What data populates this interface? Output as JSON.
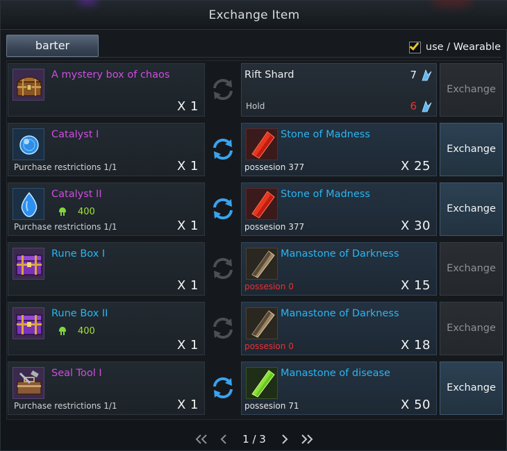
{
  "window": {
    "title": "Exchange Item"
  },
  "tabs": [
    {
      "label": "barter"
    }
  ],
  "filter": {
    "label": "use / Wearable",
    "checked": true
  },
  "rows": [
    {
      "source": {
        "name": "A mystery box of chaos",
        "qty": "X 1",
        "restriction": "",
        "cost": ""
      },
      "arrow_active": false,
      "target": {
        "name": "Rift Shard",
        "count": "7",
        "hold_label": "Hold",
        "hold": "6"
      },
      "button": {
        "label": "Exchange",
        "enabled": false
      }
    },
    {
      "source": {
        "name": "Catalyst I",
        "qty": "X 1",
        "restriction": "Purchase restrictions 1/1",
        "cost": ""
      },
      "arrow_active": true,
      "target": {
        "name": "Stone of Madness",
        "possession": "possesion 377",
        "qty": "X 25"
      },
      "button": {
        "label": "Exchange",
        "enabled": true
      }
    },
    {
      "source": {
        "name": "Catalyst II",
        "qty": "X 1",
        "restriction": "Purchase restrictions 1/1",
        "cost": "400"
      },
      "arrow_active": true,
      "target": {
        "name": "Stone of Madness",
        "possession": "possesion 377",
        "qty": "X 30"
      },
      "button": {
        "label": "Exchange",
        "enabled": true
      }
    },
    {
      "source": {
        "name": "Rune Box I",
        "qty": "X 1",
        "restriction": "",
        "cost": ""
      },
      "arrow_active": false,
      "target": {
        "name": "Manastone of Darkness",
        "possession": "possesion 0",
        "qty": "X 15"
      },
      "button": {
        "label": "Exchange",
        "enabled": false
      }
    },
    {
      "source": {
        "name": "Rune Box II",
        "qty": "X 1",
        "restriction": "",
        "cost": "400"
      },
      "arrow_active": false,
      "target": {
        "name": "Manastone of Darkness",
        "possession": "possesion 0",
        "qty": "X 18"
      },
      "button": {
        "label": "Exchange",
        "enabled": false
      }
    },
    {
      "source": {
        "name": "Seal Tool I",
        "qty": "X 1",
        "restriction": "Purchase restrictions 1/1",
        "cost": ""
      },
      "arrow_active": true,
      "target": {
        "name": "Manastone of disease",
        "possession": "possesion 71",
        "qty": "X 50"
      },
      "button": {
        "label": "Exchange",
        "enabled": true
      }
    }
  ],
  "pager": {
    "current": "1",
    "total": "3",
    "text": "1 / 3"
  },
  "colors": {
    "source_name": "#cf4de0",
    "target_name": "#2bb5f0",
    "zero_possession": "#f02e2e",
    "cost": "#a5e336",
    "checkbox_tick": "#e9c627"
  }
}
